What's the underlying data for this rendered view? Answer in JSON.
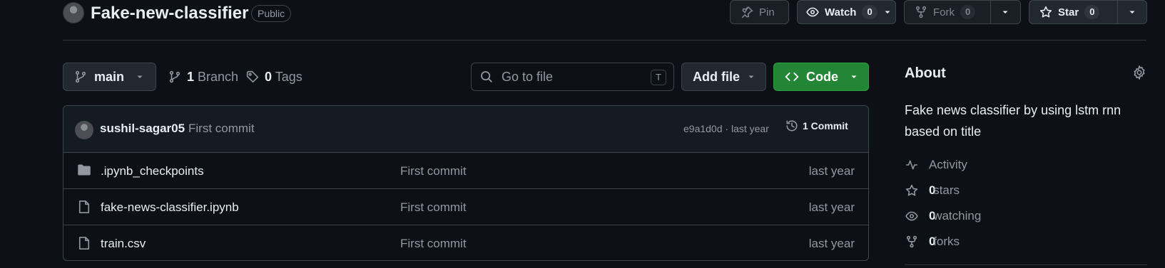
{
  "repo": {
    "name": "Fake-new-classifier",
    "visibility": "Public"
  },
  "header_actions": {
    "pin_label": "Pin",
    "watch_label": "Watch",
    "watch_count": "0",
    "fork_label": "Fork",
    "fork_count": "0",
    "star_label": "Star",
    "star_count": "0"
  },
  "toolbar": {
    "branch": "main",
    "branches_count": "1",
    "branches_label": "Branch",
    "tags_count": "0",
    "tags_label": "Tags",
    "search_placeholder": "Go to file",
    "search_shortcut": "T",
    "add_file_label": "Add file",
    "code_label": "Code"
  },
  "latest_commit": {
    "author": "sushil-sagar05",
    "message": "First commit",
    "hash_time": "e9a1d0d · last year",
    "commits_label": "1 Commit"
  },
  "files": [
    {
      "name": ".ipynb_checkpoints",
      "type": "folder",
      "message": "First commit",
      "date": "last year"
    },
    {
      "name": "fake-news-classifier.ipynb",
      "type": "file",
      "message": "First commit",
      "date": "last year"
    },
    {
      "name": "train.csv",
      "type": "file",
      "message": "First commit",
      "date": "last year"
    }
  ],
  "about": {
    "title": "About",
    "description": "Fake news classifier by using lstm rnn based on title",
    "activity_label": "Activity",
    "stars_count": "0",
    "stars_label": "stars",
    "watching_count": "0",
    "watching_label": "watching",
    "forks_count": "0",
    "forks_label": "forks"
  },
  "colors": {
    "background": "#0d1117",
    "border": "#3d444d",
    "code_button": "#238636",
    "text_primary": "#e6edf3",
    "text_muted": "#9198a1"
  },
  "icons": [
    "pin-icon",
    "eye-icon",
    "repo-forked-icon",
    "star-icon",
    "triangle-down-icon",
    "git-branch-icon",
    "tag-icon",
    "search-icon",
    "code-icon",
    "history-icon",
    "file-directory-icon",
    "file-icon",
    "gear-icon",
    "pulse-icon"
  ]
}
